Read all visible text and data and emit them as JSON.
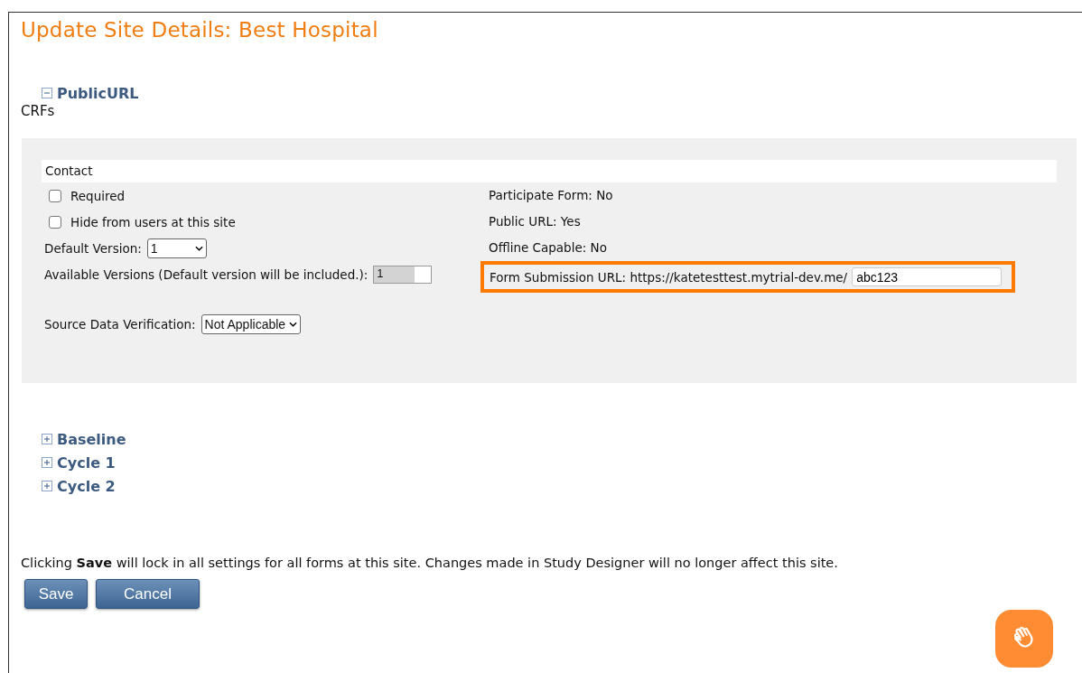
{
  "title": "Update Site Details: Best Hospital",
  "public_section": {
    "label": "PublicURL",
    "expanded": true
  },
  "crfs_label": "CRFs",
  "form": {
    "name": "Contact",
    "checkboxes": [
      {
        "label": "Required",
        "checked": false
      },
      {
        "label": "Hide from users at this site",
        "checked": false
      }
    ],
    "default_version": {
      "label": "Default Version:",
      "value": "1"
    },
    "available_versions": {
      "label": "Available Versions (Default version will be included.):",
      "value": "1"
    },
    "source_data_verification": {
      "label": "Source Data Verification:",
      "value": "Not Applicable"
    },
    "info": [
      "Participate Form:  No",
      "Public URL: Yes",
      "Offline Capable: No"
    ],
    "submission": {
      "label": "Form Submission URL: https://katetesttest.mytrial-dev.me/",
      "value": "abc123",
      "highlighted": true
    }
  },
  "sections": [
    {
      "label": "Baseline",
      "expanded": false
    },
    {
      "label": "Cycle 1",
      "expanded": false
    },
    {
      "label": "Cycle 2",
      "expanded": false
    }
  ],
  "note": "Clicking **Save** will lock in all settings for all forms at this site. Changes made in Study Designer will no longer affect this site.",
  "buttons": [
    "Save",
    "Cancel"
  ]
}
